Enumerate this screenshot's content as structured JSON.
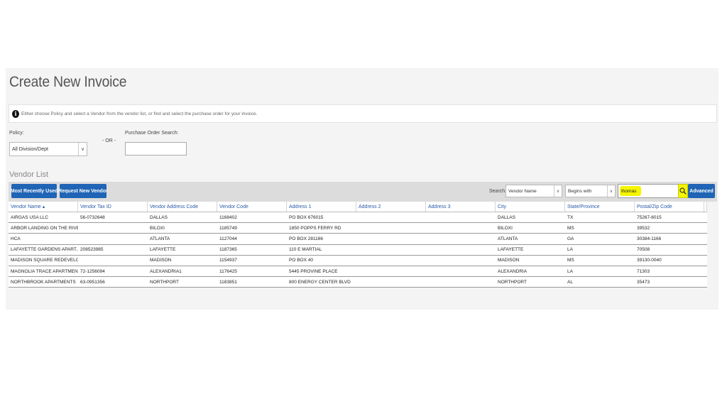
{
  "page_title": "Create New Invoice",
  "info": {
    "icon": "info-icon",
    "text": "Either choose Policy and select a Vendor from the vendor list, or find and select the purchase order for your invoice."
  },
  "policy": {
    "label": "Policy:",
    "value": "All Division/Dept"
  },
  "or_text": "- OR -",
  "po_search": {
    "label": "Purchase Order Search:",
    "value": ""
  },
  "vendor_list": {
    "title": "Vendor List",
    "buttons": {
      "recent": "Most Recently Used",
      "request": "Request New Vendor",
      "advanced": "Advanced"
    },
    "search": {
      "label": "Search:",
      "field": "Vendor Name",
      "mode": "Begins with",
      "value": "thomas",
      "highlight_color": "#f5f500"
    },
    "columns": [
      "Vendor Name ▴",
      "Vendor Tax ID",
      "Vendor Address Code",
      "Vendor Code",
      "Address 1",
      "Address 2",
      "Address 3",
      "City",
      "State/Province",
      "Postal/Zip Code"
    ],
    "rows": [
      [
        "AIRGAS USA LLC",
        "56-0732648",
        "DALLAS",
        "1168402",
        "PO BOX 676015",
        "",
        "",
        "DALLAS",
        "TX",
        "75267-6015"
      ],
      [
        "ARBOR LANDING ON THE RIVER",
        "",
        "BILOXI",
        "1185749",
        "1850 POPPS FERRY RD",
        "",
        "",
        "BILOXI",
        "MS",
        "39532"
      ],
      [
        "HCA",
        "",
        "ATLANTA",
        "1127044",
        "PO BOX 281166",
        "",
        "",
        "ATLANTA",
        "GA",
        "30384-1166"
      ],
      [
        "LAFAYETTE GARDENS APART...",
        "208523985",
        "LAFAYETTE",
        "1187365",
        "110 E MARTIAL",
        "",
        "",
        "LAFAYETTE",
        "LA",
        "70508"
      ],
      [
        "MADISON SQUARE REDEVELO...",
        "",
        "MADISON",
        "1154937",
        "PO BOX 40",
        "",
        "",
        "MADISON",
        "MS",
        "39130-0040"
      ],
      [
        "MAGNOLIA TRACE APARTMENTS",
        "72-1256094",
        "ALEXANDRIA1",
        "1176425",
        "5445 PROVINE PLACE",
        "",
        "",
        "ALEXANDRIA",
        "LA",
        "71303"
      ],
      [
        "NORTHBROOK APARTMENTS",
        "63-0951356",
        "NORTHPORT",
        "1183851",
        "800 ENERGY CENTER BLVD",
        "",
        "",
        "NORTHPORT",
        "AL",
        "35473"
      ]
    ]
  },
  "colors": {
    "accent": "#1f64b5",
    "header_link": "#2a5ca8"
  }
}
